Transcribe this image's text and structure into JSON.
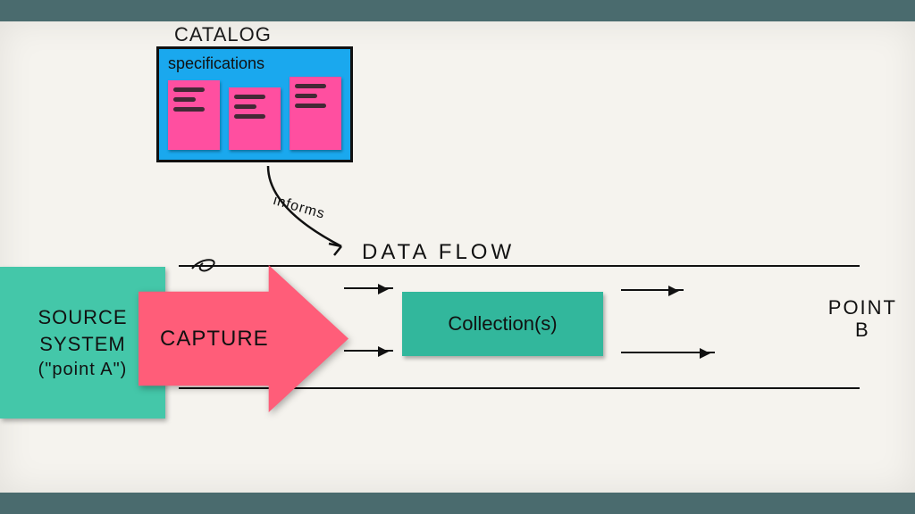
{
  "catalog": {
    "title": "CATALOG",
    "subtitle": "specifications"
  },
  "informs": {
    "label": "informs"
  },
  "dataflow": {
    "title": "DATA  FLOW"
  },
  "source": {
    "line1": "SOURCE",
    "line2": "SYSTEM",
    "sub": "(\"point A\")"
  },
  "capture": {
    "label": "CAPTURE"
  },
  "collection": {
    "label": "Collection(s)"
  },
  "pointB": {
    "line1": "POINT",
    "line2": "B"
  }
}
